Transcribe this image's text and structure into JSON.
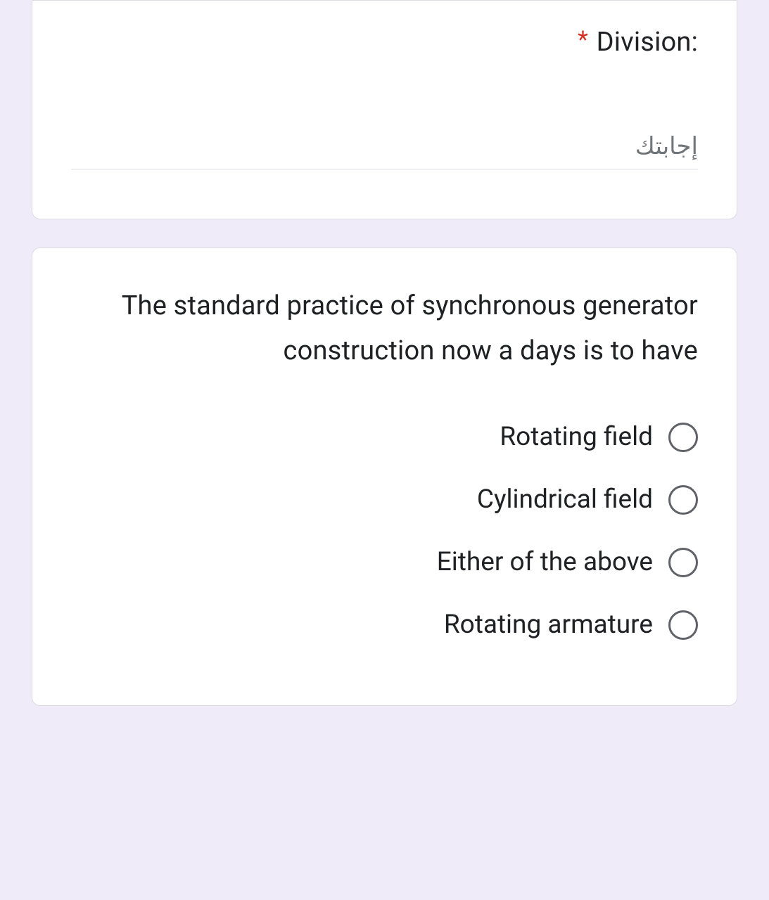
{
  "question1": {
    "label": ":Division",
    "required_mark": "*",
    "placeholder": "إجابتك"
  },
  "question2": {
    "text": "The standard practice of synchronous generator construction now a days is to have",
    "options": [
      "Rotating field",
      "Cylindrical field",
      "Either of the above",
      "Rotating armature"
    ]
  }
}
